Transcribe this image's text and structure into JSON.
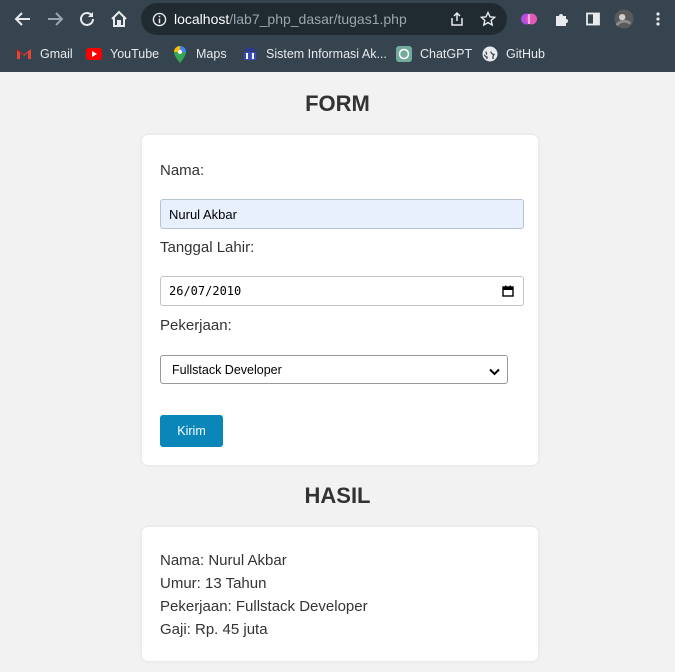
{
  "browser": {
    "url_host": "localhost",
    "url_path": "/lab7_php_dasar/tugas1.php",
    "bookmarks": [
      {
        "label": "Gmail",
        "icon": "gmail-icon"
      },
      {
        "label": "YouTube",
        "icon": "youtube-icon"
      },
      {
        "label": "Maps",
        "icon": "maps-icon"
      },
      {
        "label": "Sistem Informasi Ak...",
        "icon": "university-icon"
      },
      {
        "label": "ChatGPT",
        "icon": "chatgpt-icon"
      },
      {
        "label": "GitHub",
        "icon": "github-icon"
      }
    ]
  },
  "form": {
    "title": "FORM",
    "nama_label": "Nama:",
    "nama_value": "Nurul Akbar",
    "tanggal_label": "Tanggal Lahir:",
    "tanggal_value": "26/07/2010",
    "pekerjaan_label": "Pekerjaan:",
    "pekerjaan_value": "Fullstack Developer",
    "submit_label": "Kirim"
  },
  "hasil": {
    "title": "HASIL",
    "lines": [
      "Nama: Nurul Akbar",
      "Umur: 13 Tahun",
      "Pekerjaan: Fullstack Developer",
      "Gaji: Rp. 45 juta"
    ]
  },
  "colors": {
    "chrome_bg": "#35444e",
    "button_bg": "#0a86b8",
    "autofill_bg": "#e8f0fe"
  }
}
